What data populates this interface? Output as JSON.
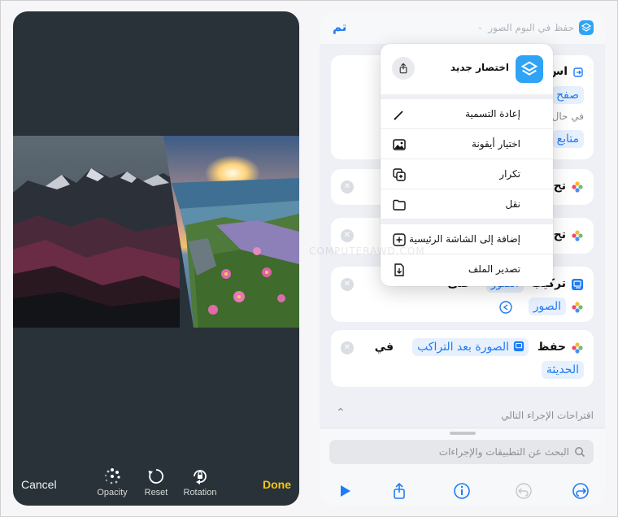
{
  "editor": {
    "cancel_label": "Cancel",
    "done_label": "Done",
    "tools": [
      {
        "label": "Opacity",
        "icon": "opacity-dots-icon"
      },
      {
        "label": "Reset",
        "icon": "reset-icon"
      },
      {
        "label": "Rotation",
        "icon": "rotation-lock-icon"
      }
    ]
  },
  "shortcuts": {
    "header": {
      "done_label": "تم",
      "title": "حفظ في البوم الصور"
    },
    "cards": {
      "card1": {
        "line1_fragment": "اس",
        "token1_fragment": "صفح",
        "line2_fragment": "في حال",
        "token2_fragment": "متابع"
      },
      "card2": {
        "text_fragment": "تح"
      },
      "card3": {
        "text_fragment": "تح"
      },
      "card4": {
        "text": "تركيب",
        "token1": "الصور",
        "word": "على",
        "token2": "الصور"
      },
      "card5": {
        "text": "حفظ",
        "token1": "الصورة بعد التراكب",
        "word": "في",
        "token2": "الحديثة"
      }
    },
    "suggestions_label": "اقتراحات الإجراء التالي",
    "search_placeholder": "البحث عن التطبيقات والإجراءات"
  },
  "menu": {
    "shortcut_name": "اختصار جديد",
    "items": [
      {
        "label": "إعادة التسمية",
        "icon": "pencil-icon"
      },
      {
        "label": "اختيار أيقونة",
        "icon": "photo-icon"
      },
      {
        "label": "تكرار",
        "icon": "duplicate-icon"
      },
      {
        "label": "نقل",
        "icon": "folder-icon"
      },
      {
        "label": "إضافة إلى الشاشة الرئيسية",
        "icon": "add-square-icon"
      },
      {
        "label": "تصدير الملف",
        "icon": "export-file-icon"
      }
    ]
  },
  "watermark": "COMPUTERAWD.COM",
  "colors": {
    "accent_blue": "#1f7cf5",
    "done_yellow": "#f5c518",
    "editor_bg": "#283238",
    "app_icon": "#2fa3f5"
  }
}
